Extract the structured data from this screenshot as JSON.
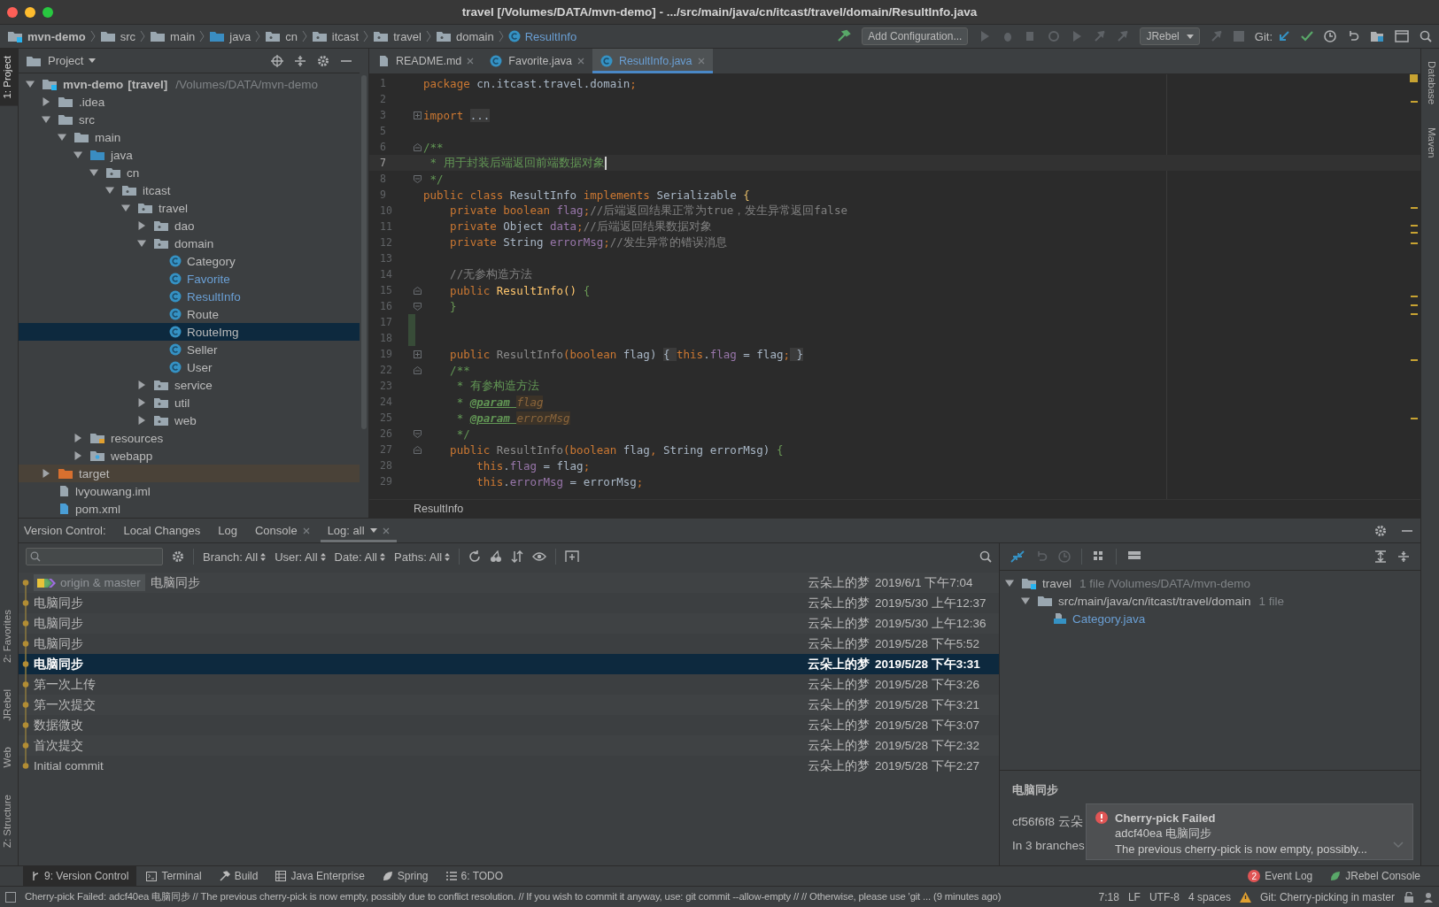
{
  "window": {
    "title": "travel [/Volumes/DATA/mvn-demo] - .../src/main/java/cn/itcast/travel/domain/ResultInfo.java"
  },
  "navbar": {
    "breadcrumbs": [
      {
        "label": "mvn-demo",
        "kind": "module"
      },
      {
        "label": "src",
        "kind": "folder"
      },
      {
        "label": "main",
        "kind": "folder"
      },
      {
        "label": "java",
        "kind": "source"
      },
      {
        "label": "cn",
        "kind": "package"
      },
      {
        "label": "itcast",
        "kind": "package"
      },
      {
        "label": "travel",
        "kind": "package"
      },
      {
        "label": "domain",
        "kind": "package"
      },
      {
        "label": "ResultInfo",
        "kind": "class"
      }
    ],
    "run_config": "Add Configuration...",
    "jrebel": "JRebel",
    "git_label": "Git:"
  },
  "left_stripe": {
    "top": [
      {
        "label": "1: Project",
        "selected": true
      }
    ],
    "bottom": [
      {
        "label": "2: Favorites",
        "selected": false
      },
      {
        "label": "JRebel",
        "selected": false
      },
      {
        "label": "Web",
        "selected": false
      },
      {
        "label": "Z: Structure",
        "selected": false
      }
    ]
  },
  "right_stripe": [
    {
      "label": "Database"
    },
    {
      "label": "Maven"
    }
  ],
  "project": {
    "title": "Project",
    "tree": [
      {
        "name": "mvn-demo",
        "module": "[travel]",
        "path": "/Volumes/DATA/mvn-demo",
        "kind": "module",
        "expanded": true,
        "selected": false,
        "children": [
          {
            "name": ".idea",
            "kind": "folder",
            "expanded": false,
            "selected": false
          },
          {
            "name": "src",
            "kind": "folder",
            "expanded": true,
            "selected": false,
            "children": [
              {
                "name": "main",
                "kind": "folder",
                "expanded": true,
                "selected": false,
                "children": [
                  {
                    "name": "java",
                    "kind": "source",
                    "expanded": true,
                    "selected": false,
                    "children": [
                      {
                        "name": "cn",
                        "kind": "package",
                        "expanded": true,
                        "selected": false,
                        "children": [
                          {
                            "name": "itcast",
                            "kind": "package",
                            "expanded": true,
                            "selected": false,
                            "children": [
                              {
                                "name": "travel",
                                "kind": "package",
                                "expanded": true,
                                "selected": false,
                                "children": [
                                  {
                                    "name": "dao",
                                    "kind": "package",
                                    "expanded": false,
                                    "selected": false
                                  },
                                  {
                                    "name": "domain",
                                    "kind": "package",
                                    "expanded": true,
                                    "selected": false,
                                    "children": [
                                      {
                                        "name": "Category",
                                        "kind": "class",
                                        "modified": false,
                                        "selected": false
                                      },
                                      {
                                        "name": "Favorite",
                                        "kind": "class",
                                        "modified": true,
                                        "selected": false
                                      },
                                      {
                                        "name": "ResultInfo",
                                        "kind": "class",
                                        "modified": true,
                                        "selected": false
                                      },
                                      {
                                        "name": "Route",
                                        "kind": "class",
                                        "modified": false,
                                        "selected": false
                                      },
                                      {
                                        "name": "RouteImg",
                                        "kind": "class",
                                        "modified": false,
                                        "selected": true
                                      },
                                      {
                                        "name": "Seller",
                                        "kind": "class",
                                        "modified": false,
                                        "selected": false
                                      },
                                      {
                                        "name": "User",
                                        "kind": "class",
                                        "modified": false,
                                        "selected": false
                                      }
                                    ]
                                  },
                                  {
                                    "name": "service",
                                    "kind": "package",
                                    "expanded": false,
                                    "selected": false
                                  },
                                  {
                                    "name": "util",
                                    "kind": "package",
                                    "expanded": false,
                                    "selected": false
                                  },
                                  {
                                    "name": "web",
                                    "kind": "package",
                                    "expanded": false,
                                    "selected": false
                                  }
                                ]
                              }
                            ]
                          }
                        ]
                      }
                    ]
                  },
                  {
                    "name": "resources",
                    "kind": "resources",
                    "expanded": false,
                    "selected": false
                  },
                  {
                    "name": "webapp",
                    "kind": "webapp",
                    "expanded": false,
                    "selected": false
                  }
                ]
              }
            ]
          },
          {
            "name": "target",
            "kind": "excluded",
            "expanded": false,
            "selected": false
          },
          {
            "name": "lvyouwang.iml",
            "kind": "iml",
            "selected": false
          },
          {
            "name": "pom.xml",
            "kind": "maven",
            "selected": false
          }
        ]
      }
    ]
  },
  "editor": {
    "tabs": [
      {
        "label": "README.md",
        "kind": "markdown",
        "selected": false
      },
      {
        "label": "Favorite.java",
        "kind": "class",
        "selected": false
      },
      {
        "label": "ResultInfo.java",
        "kind": "class",
        "selected": true
      }
    ],
    "lines": [
      {
        "number": "1",
        "tokens": [
          {
            "kind": "keyword",
            "text": "package "
          },
          {
            "kind": "plain",
            "text": "cn.itcast.travel.domain"
          },
          {
            "kind": "keyword",
            "text": ";"
          }
        ]
      },
      {
        "number": "2"
      },
      {
        "number": "3",
        "kind": "folded",
        "tokens": [
          {
            "kind": "keyword",
            "text": "import "
          },
          {
            "kind": "folded",
            "text": "..."
          }
        ]
      },
      {
        "number": "5"
      },
      {
        "number": "6",
        "kind": "fold-start",
        "tokens": [
          {
            "kind": "doc",
            "text": "/**"
          }
        ]
      },
      {
        "number": "7",
        "current": true,
        "tokens": [
          {
            "kind": "doc",
            "text": " * 用于封装后端返回前端数据对象"
          }
        ]
      },
      {
        "number": "8",
        "kind": "fold-end",
        "tokens": [
          {
            "kind": "doc",
            "text": " */"
          }
        ]
      },
      {
        "number": "9",
        "tokens": [
          {
            "kind": "keyword",
            "text": "public class "
          },
          {
            "kind": "plain",
            "text": "ResultInfo "
          },
          {
            "kind": "keyword",
            "text": "implements "
          },
          {
            "kind": "plain",
            "text": "Serializable "
          },
          {
            "kind": "brace",
            "text": "{"
          }
        ]
      },
      {
        "number": "10",
        "tokens": [
          {
            "kind": "keyword",
            "text": "    private boolean "
          },
          {
            "kind": "field",
            "text": "flag"
          },
          {
            "kind": "keyword",
            "text": ";"
          },
          {
            "kind": "comment",
            "text": "//后端返回结果正常为true，发生异常返回false"
          }
        ]
      },
      {
        "number": "11",
        "tokens": [
          {
            "kind": "keyword",
            "text": "    private "
          },
          {
            "kind": "plain",
            "text": "Object "
          },
          {
            "kind": "field",
            "text": "data"
          },
          {
            "kind": "keyword",
            "text": ";"
          },
          {
            "kind": "comment",
            "text": "//后端返回结果数据对象"
          }
        ]
      },
      {
        "number": "12",
        "tokens": [
          {
            "kind": "keyword",
            "text": "    private "
          },
          {
            "kind": "plain",
            "text": "String "
          },
          {
            "kind": "field",
            "text": "errorMsg"
          },
          {
            "kind": "keyword",
            "text": ";"
          },
          {
            "kind": "comment",
            "text": "//发生异常的错误消息"
          }
        ]
      },
      {
        "number": "13"
      },
      {
        "number": "14",
        "tokens": [
          {
            "kind": "comment",
            "text": "    //无参构造方法"
          }
        ]
      },
      {
        "number": "15",
        "kind": "fold-start",
        "tokens": [
          {
            "kind": "keyword",
            "text": "    public "
          },
          {
            "kind": "method",
            "text": "ResultInfo() "
          },
          {
            "kind": "brace-green",
            "text": "{"
          }
        ]
      },
      {
        "number": "16",
        "kind": "fold-end",
        "tokens": [
          {
            "kind": "brace-green",
            "text": "    }"
          }
        ]
      },
      {
        "number": "17",
        "changed": true
      },
      {
        "number": "18",
        "changed": true
      },
      {
        "number": "19",
        "kind": "folded",
        "tokens": [
          {
            "kind": "keyword",
            "text": "    public "
          },
          {
            "kind": "unused",
            "text": "ResultInfo"
          },
          {
            "kind": "keyword",
            "text": "(boolean "
          },
          {
            "kind": "plain",
            "text": "flag) "
          },
          {
            "kind": "folded",
            "text": "{ "
          },
          {
            "kind": "keyword",
            "text": "this"
          },
          {
            "kind": "plain",
            "text": "."
          },
          {
            "kind": "field",
            "text": "flag"
          },
          {
            "kind": "plain",
            "text": " = flag"
          },
          {
            "kind": "keyword",
            "text": ";"
          },
          {
            "kind": "folded",
            "text": " }"
          }
        ]
      },
      {
        "number": "22",
        "kind": "fold-start",
        "tokens": [
          {
            "kind": "doc",
            "text": "    /**"
          }
        ]
      },
      {
        "number": "23",
        "tokens": [
          {
            "kind": "doc",
            "text": "     * 有参构造方法"
          }
        ]
      },
      {
        "number": "24",
        "tokens": [
          {
            "kind": "doc",
            "text": "     * "
          },
          {
            "kind": "doc-tag",
            "text": "@param "
          },
          {
            "kind": "doc-param",
            "text": "flag"
          }
        ]
      },
      {
        "number": "25",
        "tokens": [
          {
            "kind": "doc",
            "text": "     * "
          },
          {
            "kind": "doc-tag",
            "text": "@param "
          },
          {
            "kind": "doc-param",
            "text": "errorMsg"
          }
        ]
      },
      {
        "number": "26",
        "kind": "fold-end",
        "tokens": [
          {
            "kind": "doc",
            "text": "     */"
          }
        ]
      },
      {
        "number": "27",
        "kind": "fold-start",
        "tokens": [
          {
            "kind": "keyword",
            "text": "    public "
          },
          {
            "kind": "unused",
            "text": "ResultInfo"
          },
          {
            "kind": "keyword",
            "text": "(boolean "
          },
          {
            "kind": "plain",
            "text": "flag"
          },
          {
            "kind": "keyword",
            "text": ", "
          },
          {
            "kind": "plain",
            "text": "String errorMsg) "
          },
          {
            "kind": "brace-green",
            "text": "{"
          }
        ]
      },
      {
        "number": "28",
        "tokens": [
          {
            "kind": "keyword",
            "text": "        this"
          },
          {
            "kind": "plain",
            "text": "."
          },
          {
            "kind": "field",
            "text": "flag"
          },
          {
            "kind": "plain",
            "text": " = flag"
          },
          {
            "kind": "keyword",
            "text": ";"
          }
        ]
      },
      {
        "number": "29",
        "tokens": [
          {
            "kind": "keyword",
            "text": "        this"
          },
          {
            "kind": "plain",
            "text": "."
          },
          {
            "kind": "field",
            "text": "errorMsg"
          },
          {
            "kind": "plain",
            "text": " = errorMsg"
          },
          {
            "kind": "keyword",
            "text": ";"
          }
        ]
      }
    ],
    "breadcrumb": "ResultInfo"
  },
  "version_control": {
    "label": "Version Control:",
    "tabs": [
      {
        "label": "Local Changes",
        "closable": false,
        "selected": false
      },
      {
        "label": "Log",
        "closable": false,
        "selected": false
      },
      {
        "label": "Console",
        "closable": true,
        "selected": false
      },
      {
        "label": "Log: all",
        "closable": true,
        "selected": true
      }
    ],
    "filters": [
      "Branch: All",
      "User: All",
      "Date: All",
      "Paths: All"
    ],
    "commits": [
      {
        "branch": "origin & master",
        "message": "电脑同步",
        "author": "云朵上的梦",
        "date": "2019/6/1 下午7:04",
        "selected": false
      },
      {
        "message": "电脑同步",
        "author": "云朵上的梦",
        "date": "2019/5/30 上午12:37",
        "selected": false
      },
      {
        "message": "电脑同步",
        "author": "云朵上的梦",
        "date": "2019/5/30 上午12:36",
        "selected": false
      },
      {
        "message": "电脑同步",
        "author": "云朵上的梦",
        "date": "2019/5/28 下午5:52",
        "selected": false
      },
      {
        "message": "电脑同步",
        "author": "云朵上的梦",
        "date": "2019/5/28 下午3:31",
        "selected": true
      },
      {
        "message": "第一次上传",
        "author": "云朵上的梦",
        "date": "2019/5/28 下午3:26",
        "selected": false
      },
      {
        "message": "第一次提交",
        "author": "云朵上的梦",
        "date": "2019/5/28 下午3:21",
        "selected": false
      },
      {
        "message": "数据微改",
        "author": "云朵上的梦",
        "date": "2019/5/28 下午3:07",
        "selected": false
      },
      {
        "message": "首次提交",
        "author": "云朵上的梦",
        "date": "2019/5/28 下午2:32",
        "selected": false
      },
      {
        "message": "Initial commit",
        "author": "云朵上的梦",
        "date": "2019/5/28 下午2:27",
        "selected": false
      }
    ],
    "changes": [
      {
        "name": "travel",
        "info": "1 file  /Volumes/DATA/mvn-demo",
        "kind": "module",
        "children": [
          {
            "name": "src/main/java/cn/itcast/travel/domain",
            "info": "1 file",
            "kind": "folder",
            "children": [
              {
                "name": "Category.java",
                "kind": "java"
              }
            ]
          }
        ]
      }
    ],
    "details": {
      "subject": "电脑同步",
      "hash_line": "cf56f6f8 云朵",
      "branches": "In 3 branches"
    }
  },
  "notification": {
    "title": "Cherry-pick Failed",
    "line": "adcf40ea 电脑同步",
    "text": "The previous cherry-pick is now empty, possibly..."
  },
  "tool_tabs": {
    "left": [
      {
        "label": "9: Version Control",
        "kind": "vcs",
        "selected": true
      },
      {
        "label": "Terminal",
        "kind": "terminal",
        "selected": false
      },
      {
        "label": "Build",
        "kind": "build",
        "selected": false
      },
      {
        "label": "Java Enterprise",
        "kind": "enterprise",
        "selected": false
      },
      {
        "label": "Spring",
        "kind": "spring",
        "selected": false
      },
      {
        "label": "6: TODO",
        "kind": "todo",
        "selected": false
      }
    ],
    "right": [
      {
        "label": "Event Log",
        "badge": "2",
        "kind": "event"
      },
      {
        "label": "JRebel Console",
        "kind": "jrebel"
      }
    ]
  },
  "status_bar": {
    "message": "Cherry-pick Failed: adcf40ea 电脑同步 // The previous cherry-pick is now empty, possibly due to conflict resolution. // If you wish to commit it anyway, use: git commit --allow-empty // // Otherwise, please use 'git ... (9 minutes ago)",
    "position": "7:18",
    "line_separator": "LF",
    "encoding": "UTF-8",
    "indent": "4 spaces",
    "git": "Git: Cherry-picking in master"
  }
}
